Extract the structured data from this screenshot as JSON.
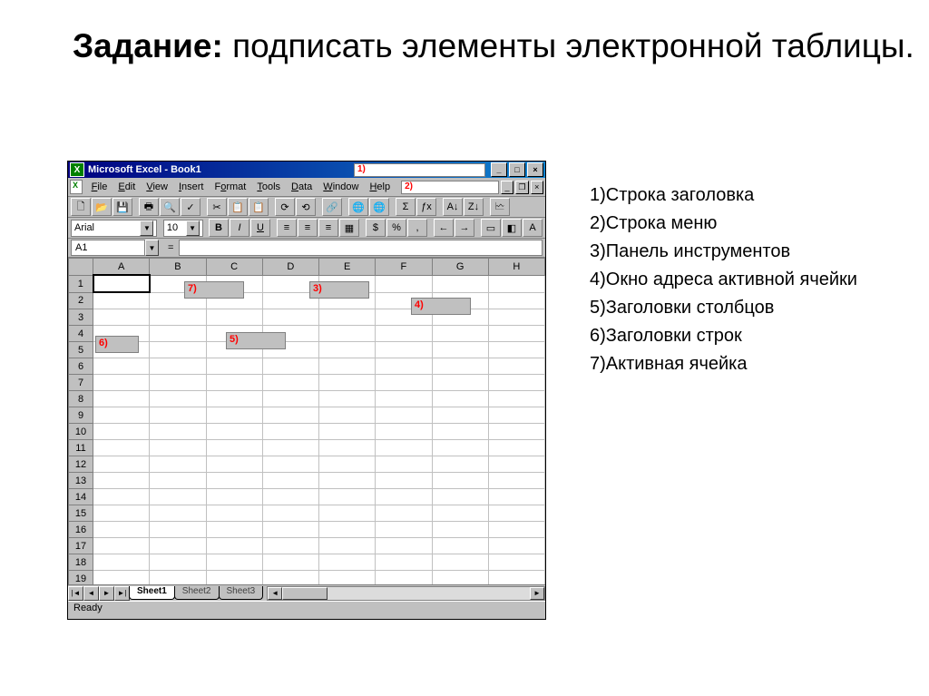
{
  "slide": {
    "title_bold": "Задание:",
    "title_rest": " подписать элементы электронной таблицы."
  },
  "excel": {
    "title": "Microsoft Excel - Book1",
    "menu": [
      "File",
      "Edit",
      "View",
      "Insert",
      "Format",
      "Tools",
      "Data",
      "Window",
      "Help"
    ],
    "font_name": "Arial",
    "font_size": "10",
    "name_box": "A1",
    "sheet_tabs": [
      "Sheet1",
      "Sheet2",
      "Sheet3"
    ],
    "status": "Ready",
    "columns": [
      "A",
      "B",
      "C",
      "D",
      "E",
      "F",
      "G",
      "H"
    ],
    "row_count": 19,
    "toolbar_icons": [
      "🗋",
      "📂",
      "💾",
      "🖶",
      "🔍",
      "✓",
      "✂",
      "📋",
      "📋",
      "⟳",
      "⟲",
      "🔗",
      "🌐",
      "🌐",
      "Σ",
      "ƒx",
      "A↓",
      "Z↓",
      "🗠"
    ],
    "format_icons": [
      "B",
      "I",
      "U",
      "≡",
      "≡",
      "≡",
      "▦",
      "$",
      "%",
      ",",
      "←",
      "→",
      "▭",
      "◧",
      "A"
    ]
  },
  "labels": {
    "l1": "1)",
    "l2": "2)",
    "l3": "3)",
    "l4": "4)",
    "l5": "5)",
    "l6": "6)",
    "l7": "7)"
  },
  "answers": {
    "a1": "1)Строка заголовка",
    "a2": "2)Строка меню",
    "a3": "3)Панель инструментов",
    "a4": "4)Окно адреса активной ячейки",
    "a5": "5)Заголовки столбцов",
    "a6": "6)Заголовки строк",
    "a7": "7)Активная ячейка"
  }
}
